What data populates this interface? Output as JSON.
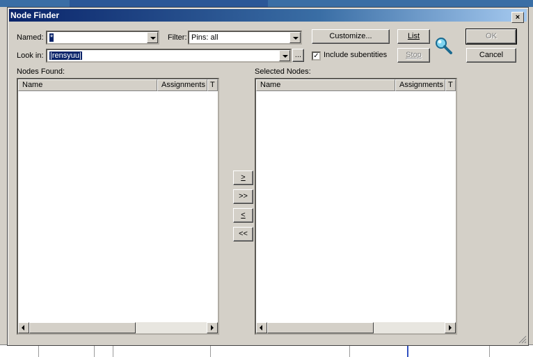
{
  "dialog": {
    "title": "Node Finder",
    "close_glyph": "×"
  },
  "named": {
    "label": "Named:",
    "value": "*"
  },
  "filter": {
    "label": "Filter:",
    "value": "Pins: all"
  },
  "look_in": {
    "label": "Look in:",
    "value": "|rensyuu|",
    "browse_label": "..."
  },
  "buttons": {
    "customize": "Customize...",
    "list": "List",
    "stop": "Stop",
    "ok": "OK",
    "cancel": "Cancel"
  },
  "include_subentities": {
    "label": "Include subentities",
    "checked": true,
    "mark": "✓"
  },
  "nodes_found": {
    "label": "Nodes Found:",
    "columns": [
      "Name",
      "Assignments",
      "T"
    ],
    "rows": []
  },
  "selected_nodes": {
    "label": "Selected Nodes:",
    "columns": [
      "Name",
      "Assignments",
      "T"
    ],
    "rows": []
  },
  "move_buttons": [
    ">",
    ">>",
    "<",
    "<<"
  ],
  "icons": {
    "search": "magnifier-icon"
  },
  "colors": {
    "title_start": "#0a246a",
    "title_end": "#a6caf0",
    "face": "#d4d0c8",
    "selection": "#0a246a"
  }
}
